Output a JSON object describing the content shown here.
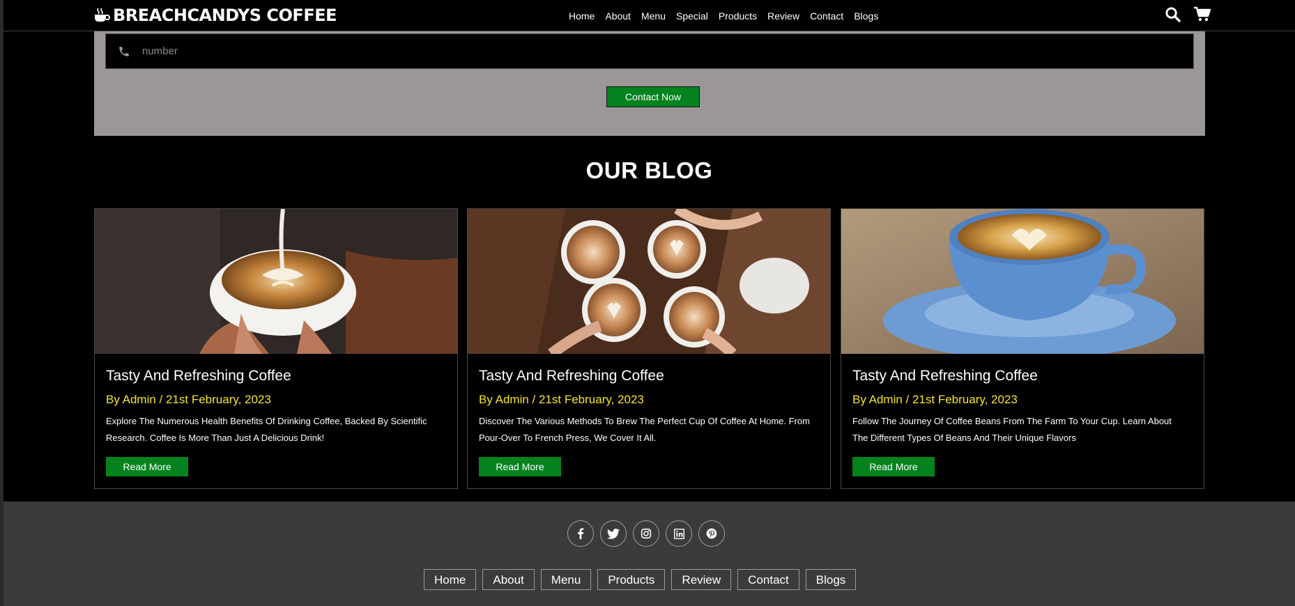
{
  "header": {
    "logo_text": "BREACHCANDYS COFFEE",
    "nav": [
      "Home",
      "About",
      "Menu",
      "Special",
      "Products",
      "Review",
      "Contact",
      "Blogs"
    ]
  },
  "contact": {
    "phone_placeholder": "number",
    "submit_label": "Contact Now"
  },
  "blog": {
    "title": "OUR BLOG",
    "cards": [
      {
        "title": "Tasty And Refreshing Coffee",
        "meta": "By Admin / 21st February, 2023",
        "desc": "Explore The Numerous Health Benefits Of Drinking Coffee, Backed By Scientific Research. Coffee Is More Than Just A Delicious Drink!",
        "button": "Read More"
      },
      {
        "title": "Tasty And Refreshing Coffee",
        "meta": "By Admin / 21st February, 2023",
        "desc": "Discover The Various Methods To Brew The Perfect Cup Of Coffee At Home. From Pour-Over To French Press, We Cover It All.",
        "button": "Read More"
      },
      {
        "title": "Tasty And Refreshing Coffee",
        "meta": "By Admin / 21st February, 2023",
        "desc": "Follow The Journey Of Coffee Beans From The Farm To Your Cup. Learn About The Different Types Of Beans And Their Unique Flavors",
        "button": "Read More"
      }
    ]
  },
  "footer": {
    "socials": [
      "facebook-icon",
      "twitter-icon",
      "instagram-icon",
      "linkedin-icon",
      "pinterest-icon"
    ],
    "nav": [
      "Home",
      "About",
      "Menu",
      "Products",
      "Review",
      "Contact",
      "Blogs"
    ]
  },
  "colors": {
    "accent_green": "#03821e",
    "meta_yellow": "#f7e52b",
    "contact_bg": "#9b9797",
    "footer_bg": "#3b3b3b"
  }
}
